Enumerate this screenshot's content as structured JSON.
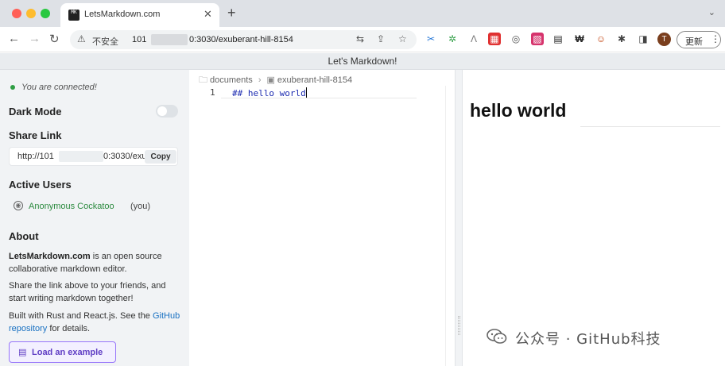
{
  "browser": {
    "tab": {
      "title": "LetsMarkdown.com",
      "favicon_text": "MK",
      "close_glyph": "✕"
    },
    "new_tab_glyph": "+",
    "tab_menu_glyph": "⌄",
    "nav": {
      "back": "←",
      "forward": "→",
      "reload": "↻"
    },
    "address": {
      "security_label": "不安全",
      "url_prefix": "101",
      "url_suffix": "0:3030/exuberant-hill-8154"
    },
    "omnibox_icons": {
      "translate": "⇆",
      "share": "⇪",
      "bookmark": "☆"
    },
    "extensions": [
      "✂",
      "✲",
      "Λ",
      "▦",
      "◎",
      "▧",
      "▤",
      "₩",
      "☺",
      "✱",
      "◨"
    ],
    "profile_initial": "T",
    "update_label": "更新",
    "menu_glyph": "⋮"
  },
  "app": {
    "header_title": "Let's Markdown!"
  },
  "sidebar": {
    "connection_status": "You are connected!",
    "dark_mode_label": "Dark Mode",
    "dark_mode_on": false,
    "share_link_heading": "Share Link",
    "share_link_prefix": "http://101",
    "share_link_suffix": "0:3030/exu",
    "copy_label": "Copy",
    "active_users_heading": "Active Users",
    "users": [
      {
        "name": "Anonymous Cockatoo",
        "suffix": "(you)",
        "color": "#2b8a3e"
      }
    ],
    "about_heading": "About",
    "about": {
      "p1_bold": "LetsMarkdown.com",
      "p1_rest": " is an open source collaborative markdown editor.",
      "p2": "Share the link above to your friends, and start writing markdown together!",
      "p3_a": "Built with Rust and React.js. See the ",
      "p3_link": "GitHub repository",
      "p3_b": " for details."
    },
    "load_example_label": "Load an example"
  },
  "editor": {
    "breadcrumb": [
      "documents",
      "exuberant-hill-8154"
    ],
    "lines": [
      {
        "number": "1",
        "text": "## hello world"
      }
    ]
  },
  "preview": {
    "heading": "hello world"
  },
  "watermark": {
    "text": "公众号 · GitHub科技"
  },
  "colors": {
    "accent_purple": "#5f3dc4",
    "connected_green": "#2f9e44",
    "link_blue": "#1971c2"
  }
}
